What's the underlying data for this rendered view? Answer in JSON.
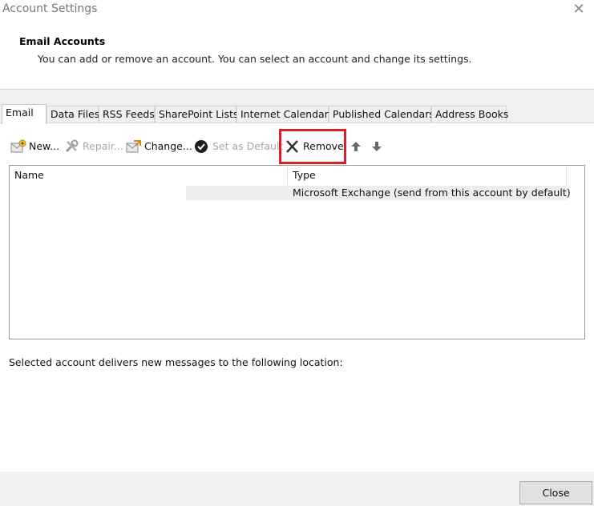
{
  "window": {
    "title": "Account Settings"
  },
  "header": {
    "title": "Email Accounts",
    "subtitle": "You can add or remove an account. You can select an account and change its settings."
  },
  "tabs": [
    {
      "label": "Email",
      "active": true
    },
    {
      "label": "Data Files"
    },
    {
      "label": "RSS Feeds"
    },
    {
      "label": "SharePoint Lists"
    },
    {
      "label": "Internet Calendars"
    },
    {
      "label": "Published Calendars"
    },
    {
      "label": "Address Books"
    }
  ],
  "toolbar": {
    "new_label": "New...",
    "repair_label": "Repair...",
    "change_label": "Change...",
    "set_default_label": "Set as Default",
    "remove_label": "Remove",
    "highlight_color": "#d9202a"
  },
  "table": {
    "columns": [
      "Name",
      "Type"
    ],
    "rows": [
      {
        "name": "",
        "type": "Microsoft Exchange (send from this account by default)"
      }
    ]
  },
  "footer": {
    "delivery_text": "Selected account delivers new messages to the following location:",
    "close_label": "Close"
  }
}
